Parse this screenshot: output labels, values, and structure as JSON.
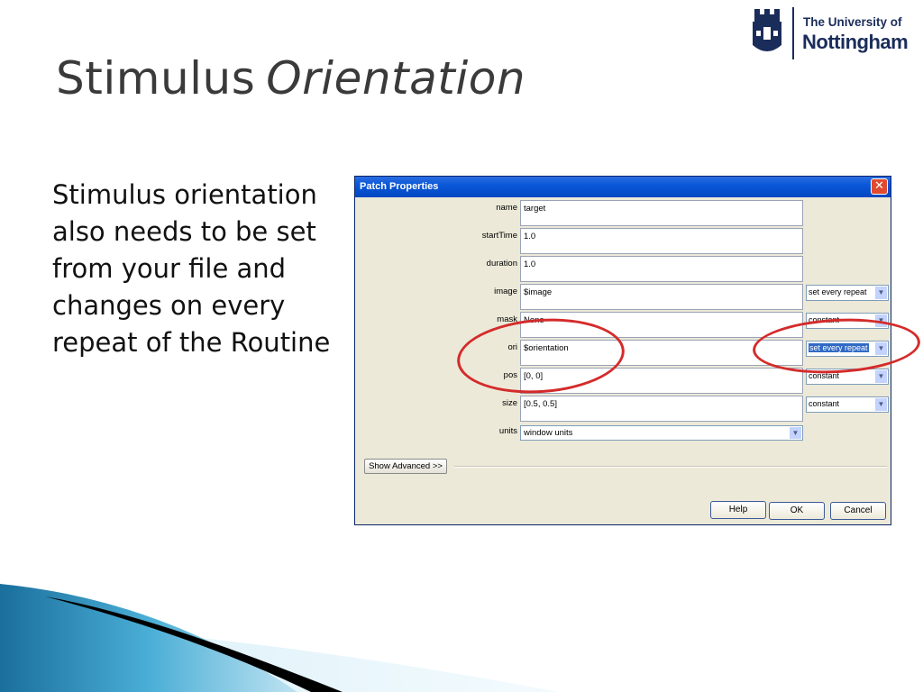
{
  "slide": {
    "title_part1": "Stimulus",
    "title_part2": "Orientation",
    "body": "Stimulus orientation also needs to be set from your file and changes on every repeat of the Routine"
  },
  "logo": {
    "line1": "The University of",
    "line2": "Nottingham"
  },
  "dialog": {
    "title": "Patch Properties",
    "close_symbol": "✕",
    "fields": [
      {
        "label": "name",
        "value": "target"
      },
      {
        "label": "startTime",
        "value": "1.0"
      },
      {
        "label": "duration",
        "value": "1.0"
      },
      {
        "label": "image",
        "value": "$image",
        "updates": "set every repeat"
      },
      {
        "label": "mask",
        "value": "None",
        "updates": "constant"
      },
      {
        "label": "ori",
        "value": "$orientation",
        "updates": "set every repeat"
      },
      {
        "label": "pos",
        "value": "[0, 0]",
        "updates": "constant"
      },
      {
        "label": "size",
        "value": "[0.5, 0.5]",
        "updates": "constant"
      }
    ],
    "units": {
      "label": "units",
      "value": "window units"
    },
    "show_advanced": "Show Advanced >>",
    "buttons": {
      "help": "Help",
      "ok": "OK",
      "cancel": "Cancel"
    }
  },
  "colors": {
    "annotation_circle": "#d42b2b",
    "titlebar": "#0a58d8",
    "dialog_bg": "#ece9d8",
    "logo_blue": "#1a2c5a"
  },
  "icons": [
    "university-crest-icon",
    "close-icon",
    "chevron-down-icon"
  ]
}
